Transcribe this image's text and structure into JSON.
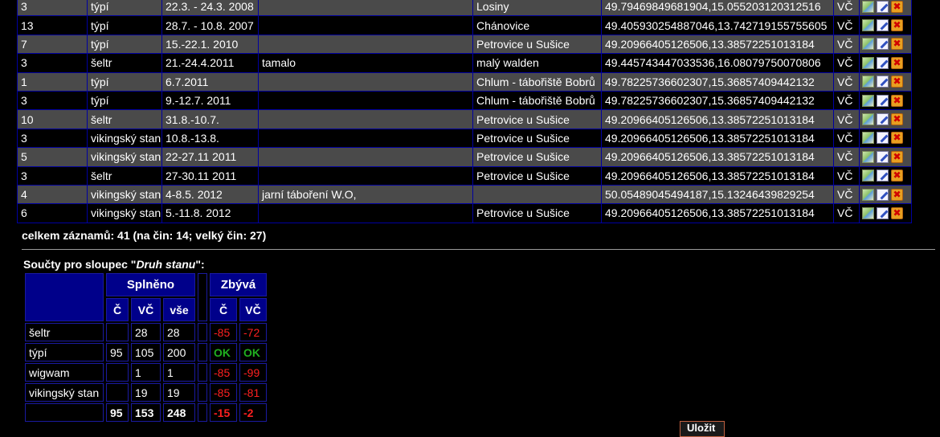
{
  "records": [
    {
      "count": "3",
      "type": "týpí",
      "date": "22.3. - 24.3. 2008",
      "note": "",
      "place": "Losiny",
      "coords": "49.79469849681904,15.055203120312516",
      "cat": "VČ"
    },
    {
      "count": "13",
      "type": "týpí",
      "date": "28.7. - 10.8. 2007",
      "note": "",
      "place": "Chánovice",
      "coords": "49.40593025488704​6,13.742719155755605",
      "cat": "VČ"
    },
    {
      "count": "7",
      "type": "týpí",
      "date": "15.-22.1. 2010",
      "note": "",
      "place": "Petrovice u Sušice",
      "coords": "49.20966405126506,13.38572251013184",
      "cat": "VČ"
    },
    {
      "count": "3",
      "type": "šeltr",
      "date": "21.-24.4.2011",
      "note": "tamalo",
      "place": "malý walden",
      "coords": "49.445743447033536,16.08079750070806",
      "cat": "VČ"
    },
    {
      "count": "1",
      "type": "týpí",
      "date": "6.7.2011",
      "note": "",
      "place": "Chlum - tábořiště Bobrů",
      "coords": "49.78225736602307,15.36857409442132",
      "cat": "VČ"
    },
    {
      "count": "3",
      "type": "týpí",
      "date": "9.-12.7. 2011",
      "note": "",
      "place": "Chlum - tábořiště Bobrů",
      "coords": "49.78225736602307,15.36857409442132",
      "cat": "VČ"
    },
    {
      "count": "10",
      "type": "šeltr",
      "date": "31.8.-10.7.",
      "note": "",
      "place": "Petrovice u Sušice",
      "coords": "49.20966405126506,13.38572251013184",
      "cat": "VČ"
    },
    {
      "count": "3",
      "type": "vikingský stan",
      "date": "10.8.-13.8.",
      "note": "",
      "place": "Petrovice u Sušice",
      "coords": "49.20966405126506,13.38572251013184",
      "cat": "VČ"
    },
    {
      "count": "5",
      "type": "vikingský stan",
      "date": "22-27.11 2011",
      "note": "",
      "place": "Petrovice u Sušice",
      "coords": "49.20966405126506,13.38572251013184",
      "cat": "VČ"
    },
    {
      "count": "3",
      "type": "šeltr",
      "date": "27-30.11 2011",
      "note": "",
      "place": "Petrovice u Sušice",
      "coords": "49.20966405126506,13.38572251013184",
      "cat": "VČ"
    },
    {
      "count": "4",
      "type": "vikingský stan",
      "date": "4-8.5. 2012",
      "note": "jarní táboření W.O,",
      "place": "",
      "coords": "50.05489045494187,15.13246439829254",
      "cat": "VČ"
    },
    {
      "count": "6",
      "type": "vikingský stan",
      "date": "5.-11.8. 2012",
      "note": "",
      "place": "Petrovice u Sušice",
      "coords": "49.20966405126506,13.38572251013184",
      "cat": "VČ"
    }
  ],
  "icons": {
    "map": "map-icon",
    "edit": "edit-icon",
    "delete": "delete-icon"
  },
  "summary": {
    "total_text": "celkem záznamů: 41 (na čin: 14; velký čin: 27)",
    "sums_title_prefix": "Součty pro sloupec \"",
    "sums_title_column": "Druh stanu",
    "sums_title_suffix": "\":"
  },
  "sums": {
    "group_done": "Splněno",
    "group_left": "Zbývá",
    "col_c": "Č",
    "col_vc": "VČ",
    "col_all": "vše",
    "rows": [
      {
        "label": "šeltr",
        "c": "",
        "vc": "28",
        "all": "28",
        "left_c": "-85",
        "left_vc": "-72"
      },
      {
        "label": "týpí",
        "c": "95",
        "vc": "105",
        "all": "200",
        "left_c": "OK",
        "left_vc": "OK"
      },
      {
        "label": "wigwam",
        "c": "",
        "vc": "1",
        "all": "1",
        "left_c": "-85",
        "left_vc": "-99"
      },
      {
        "label": "vikingský stan",
        "c": "",
        "vc": "19",
        "all": "19",
        "left_c": "-85",
        "left_vc": "-81"
      }
    ],
    "totals": {
      "label": "",
      "c": "95",
      "vc": "153",
      "all": "248",
      "left_c": "-15",
      "left_vc": "-2"
    }
  },
  "colors": {
    "row_odd": "#4a4a4a",
    "row_even": "#000000",
    "grid": "#0000a0",
    "negative": "#ff2020",
    "ok": "#20b020"
  },
  "button": {
    "label": "Uložit"
  }
}
